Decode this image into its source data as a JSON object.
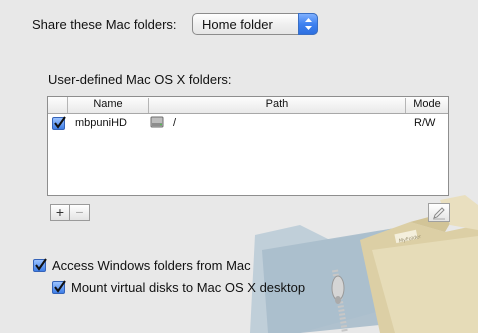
{
  "share": {
    "label": "Share these Mac folders:",
    "selected": "Home folder"
  },
  "user_defined": {
    "title": "User-defined Mac OS X folders:",
    "columns": [
      "Name",
      "Path",
      "Mode"
    ],
    "rows": [
      {
        "checked": true,
        "name": "mbpuniHD",
        "path": "/",
        "mode": "R/W"
      }
    ]
  },
  "buttons": {
    "add": "+",
    "remove": "−"
  },
  "options": {
    "access_windows": {
      "label": "Access Windows folders from Mac",
      "checked": true
    },
    "mount_disks": {
      "label": "Mount virtual disks to Mac OS X desktop",
      "checked": true
    }
  },
  "illustration": {
    "folder_tab_text": "MyFolder"
  },
  "colors": {
    "background": "#e8e8e8",
    "accent": "#3f82f0"
  }
}
